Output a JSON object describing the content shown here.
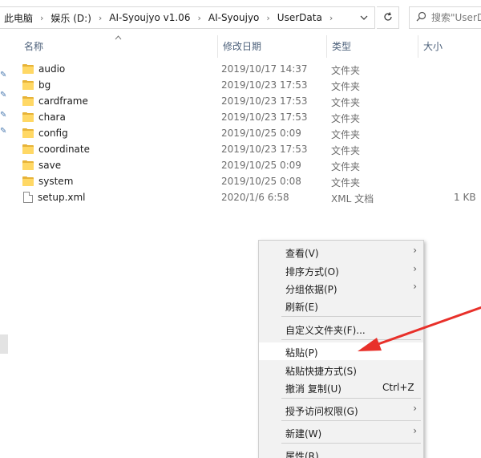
{
  "address_bar": {
    "breadcrumbs": [
      "此电脑",
      "娱乐 (D:)",
      "AI-Syoujyo v1.06",
      "AI-Syoujyo",
      "UserData"
    ],
    "separator": "›",
    "dropdown_icon": "chevron-down-icon",
    "refresh_icon": "refresh-icon"
  },
  "search": {
    "placeholder": "搜索\"UserData\"",
    "icon": "search-icon"
  },
  "columns": {
    "name": "名称",
    "date": "修改日期",
    "type": "类型",
    "size": "大小"
  },
  "files": [
    {
      "name": "audio",
      "date": "2019/10/17 14:37",
      "type": "文件夹",
      "size": "",
      "kind": "folder"
    },
    {
      "name": "bg",
      "date": "2019/10/23 17:53",
      "type": "文件夹",
      "size": "",
      "kind": "folder"
    },
    {
      "name": "cardframe",
      "date": "2019/10/23 17:53",
      "type": "文件夹",
      "size": "",
      "kind": "folder"
    },
    {
      "name": "chara",
      "date": "2019/10/23 17:53",
      "type": "文件夹",
      "size": "",
      "kind": "folder"
    },
    {
      "name": "config",
      "date": "2019/10/25 0:09",
      "type": "文件夹",
      "size": "",
      "kind": "folder"
    },
    {
      "name": "coordinate",
      "date": "2019/10/23 17:53",
      "type": "文件夹",
      "size": "",
      "kind": "folder"
    },
    {
      "name": "save",
      "date": "2019/10/25 0:09",
      "type": "文件夹",
      "size": "",
      "kind": "folder"
    },
    {
      "name": "system",
      "date": "2019/10/25 0:08",
      "type": "文件夹",
      "size": "",
      "kind": "folder"
    },
    {
      "name": "setup.xml",
      "date": "2020/1/6 6:58",
      "type": "XML 文档",
      "size": "1 KB",
      "kind": "file"
    }
  ],
  "context_menu": {
    "items": [
      {
        "label": "查看(V)",
        "submenu": true
      },
      {
        "label": "排序方式(O)",
        "submenu": true
      },
      {
        "label": "分组依据(P)",
        "submenu": true
      },
      {
        "label": "刷新(E)",
        "submenu": false
      },
      {
        "label": "自定义文件夹(F)...",
        "submenu": false
      },
      {
        "label": "粘贴(P)",
        "submenu": false,
        "highlighted": true
      },
      {
        "label": "粘贴快捷方式(S)",
        "submenu": false
      },
      {
        "label": "撤消 复制(U)",
        "submenu": false,
        "shortcut": "Ctrl+Z"
      },
      {
        "label": "授予访问权限(G)",
        "submenu": true
      },
      {
        "label": "新建(W)",
        "submenu": true
      },
      {
        "label": "属性(R)",
        "submenu": false
      }
    ]
  },
  "colors": {
    "annotation_arrow": "#e8302a",
    "folder": "#ffd865",
    "menu_bg": "#f2f2f2",
    "header_text": "#4c607a"
  }
}
